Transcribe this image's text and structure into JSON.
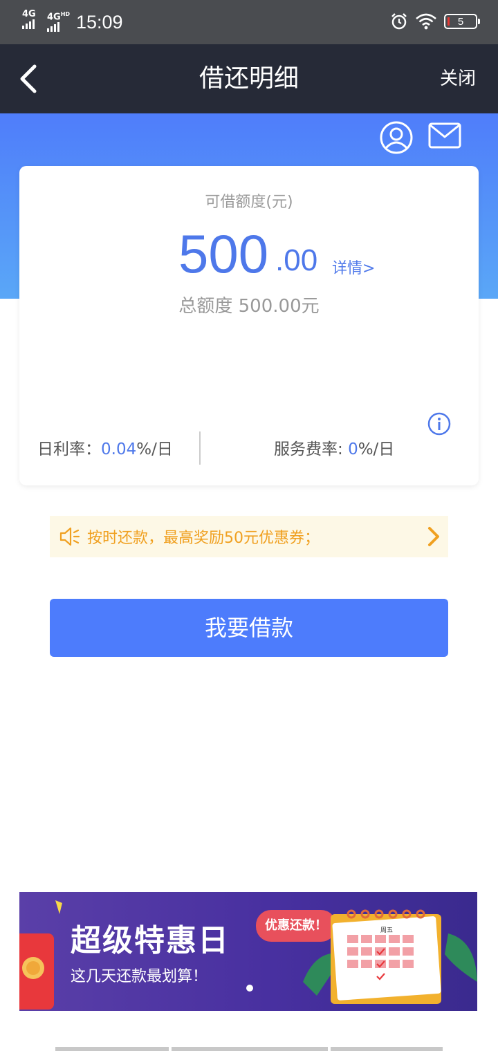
{
  "status_bar": {
    "network_1": "4G",
    "network_2": "4G",
    "network_2_suffix": "HD",
    "time": "15:09",
    "battery": "5",
    "icons": [
      "alarm-icon",
      "wifi-icon",
      "battery-icon"
    ]
  },
  "nav": {
    "title": "借还明细",
    "close": "关闭",
    "back_icon": "chevron-left-icon"
  },
  "header_icons": [
    "user-icon",
    "mail-icon"
  ],
  "card": {
    "available_label": "可借额度(元)",
    "amount_int": "500",
    "amount_dec": ".00",
    "detail_link": "详情>",
    "total_label": "总额度 500.00元",
    "daily_rate_label": "日利率：",
    "daily_rate_value": "0.04",
    "daily_rate_unit": "%/日",
    "service_rate_label": "服务费率: ",
    "service_rate_value": "0",
    "service_rate_unit": "%/日"
  },
  "notice": {
    "text": "按时还款，最高奖励50元优惠券；"
  },
  "borrow_button": "我要借款",
  "promo": {
    "title": "超级特惠日",
    "subtitle": "这几天还款最划算！",
    "bubble": "优惠还款！",
    "calendar_label": "周五"
  },
  "colors": {
    "status_bar": "#4a4c50",
    "nav_bar": "#262a37",
    "accent_blue": "#4e78ea",
    "button_blue": "#4d7cfc",
    "notice_text": "#f0a020",
    "notice_bg": "#fdf8e6"
  }
}
